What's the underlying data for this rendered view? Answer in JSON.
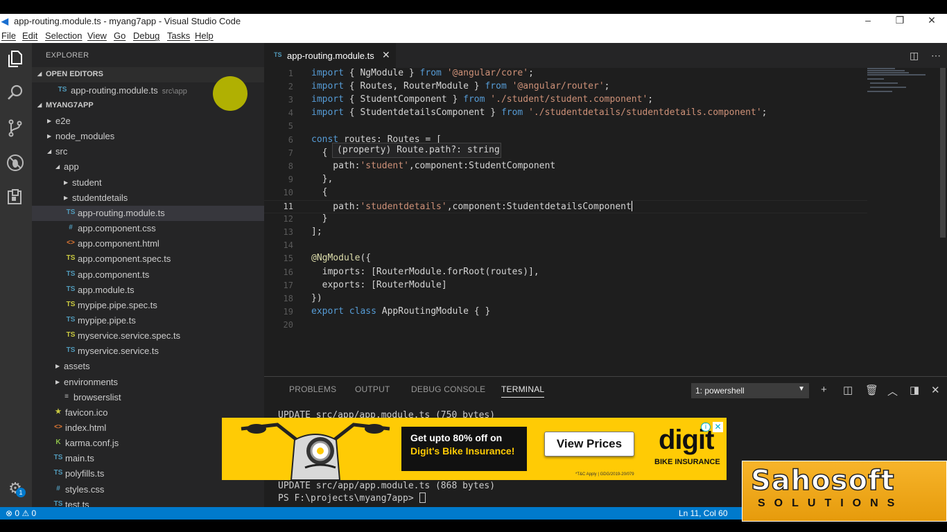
{
  "window": {
    "title": "app-routing.module.ts - myang7app - Visual Studio Code",
    "controls": {
      "minimize": "–",
      "restore": "❐",
      "close": "✕"
    }
  },
  "menu": [
    "File",
    "Edit",
    "Selection",
    "View",
    "Go",
    "Debug",
    "Tasks",
    "Help"
  ],
  "activity_bar": {
    "icons": [
      "explorer-icon",
      "search-icon",
      "source-control-icon",
      "debug-icon",
      "extensions-icon"
    ],
    "settings_badge": "1"
  },
  "explorer": {
    "header": "EXPLORER",
    "open_editors_label": "OPEN EDITORS",
    "open_editors": [
      {
        "name": "app-routing.module.ts",
        "path": "src\\app"
      }
    ],
    "project_label": "MYANG7APP",
    "tree": [
      {
        "name": "e2e",
        "type": "folder-collapsed"
      },
      {
        "name": "node_modules",
        "type": "folder-collapsed"
      },
      {
        "name": "src",
        "type": "folder-open"
      },
      {
        "name": "app",
        "type": "folder-open"
      },
      {
        "name": "student",
        "type": "folder-collapsed"
      },
      {
        "name": "studentdetails",
        "type": "folder-collapsed"
      },
      {
        "name": "app-routing.module.ts",
        "type": "ts",
        "selected": true
      },
      {
        "name": "app.component.css",
        "type": "css"
      },
      {
        "name": "app.component.html",
        "type": "html"
      },
      {
        "name": "app.component.spec.ts",
        "type": "tsspec"
      },
      {
        "name": "app.component.ts",
        "type": "ts"
      },
      {
        "name": "app.module.ts",
        "type": "ts"
      },
      {
        "name": "mypipe.pipe.spec.ts",
        "type": "tsspec"
      },
      {
        "name": "mypipe.pipe.ts",
        "type": "ts"
      },
      {
        "name": "myservice.service.spec.ts",
        "type": "tsspec"
      },
      {
        "name": "myservice.service.ts",
        "type": "ts"
      },
      {
        "name": "assets",
        "type": "folder-collapsed"
      },
      {
        "name": "environments",
        "type": "folder-collapsed"
      },
      {
        "name": "browserslist",
        "type": "lines"
      },
      {
        "name": "favicon.ico",
        "type": "star"
      },
      {
        "name": "index.html",
        "type": "html"
      },
      {
        "name": "karma.conf.js",
        "type": "karma"
      },
      {
        "name": "main.ts",
        "type": "ts"
      },
      {
        "name": "polyfills.ts",
        "type": "ts"
      },
      {
        "name": "styles.css",
        "type": "css"
      },
      {
        "name": "test.ts",
        "type": "ts"
      }
    ]
  },
  "editor": {
    "tab": {
      "badge": "TS",
      "name": "app-routing.module.ts",
      "close": "✕"
    },
    "hover": "(property) Route.path?: string",
    "current_line": 11,
    "lines": [
      "import { NgModule } from '@angular/core';",
      "import { Routes, RouterModule } from '@angular/router';",
      "import { StudentComponent } from './student/student.component';",
      "import { StudentdetailsComponent } from './studentdetails/studentdetails.component';",
      "",
      "const routes: Routes = [",
      "  {",
      "    path:'student',component:StudentComponent",
      "  },",
      "  {",
      "    path:'studentdetails',component:StudentdetailsComponent",
      "  }",
      "];",
      "",
      "@NgModule({",
      "  imports: [RouterModule.forRoot(routes)],",
      "  exports: [RouterModule]",
      "})",
      "export class AppRoutingModule { }",
      ""
    ]
  },
  "panel": {
    "tabs": [
      "PROBLEMS",
      "OUTPUT",
      "DEBUG CONSOLE",
      "TERMINAL"
    ],
    "active_tab": "TERMINAL",
    "terminal_select": "1: powershell",
    "terminal_lines": [
      "UPDATE src/app/app.module.ts (750 bytes)",
      "UPDATE src/app/app.module.ts (868 bytes)",
      "PS F:\\projects\\myang7app> "
    ]
  },
  "status": {
    "errors": "0",
    "warnings": "0",
    "position": "Ln 11, Col 60"
  },
  "ad": {
    "line1": "Get upto 80% off on",
    "line2": "Digit's Bike Insurance!",
    "cta": "View Prices",
    "logo": "digit",
    "logo_sub": "BIKE INSURANCE",
    "tnc": "*T&C Apply | GDG/2019-20/079"
  },
  "watermark": {
    "line1": "Sahosoft",
    "line2": "SOLUTIONS"
  },
  "colors": {
    "statusbar": "#007acc",
    "ad_bg": "#ffcb05",
    "keyword": "#569cd6",
    "string": "#ce9178"
  }
}
